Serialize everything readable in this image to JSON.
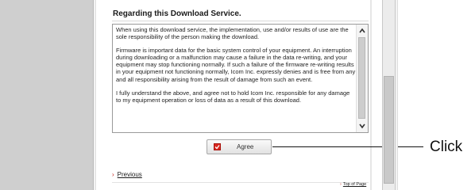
{
  "section": {
    "title": "Regarding this Download Service."
  },
  "terms": {
    "paragraphs": [
      "When using this download service, the implementation, use and/or results of use are the sole responsibility of the person making the download.",
      "Firmware is important data for the basic system control of your equipment. An interruption during downloading or a malfunction may cause a failure in the data re-writing, and your equipment may stop functioning normally. If such a failure of the firmware re-writing results in your equipment not functioning normally, Icom Inc. expressly denies and is free from any and all responsibility arising from the result of damage from such an event.",
      "I fully understand the above, and agree not to hold Icom Inc. responsible for any damage to my equipment operation or loss of data as a result of this download."
    ],
    "scroll_up_icon": "chevron-up",
    "scroll_down_icon": "chevron-down"
  },
  "agree": {
    "label": "Agree",
    "check_icon": "checkbox-icon",
    "check_color": "#d9281f"
  },
  "callout": {
    "text": "Click"
  },
  "nav": {
    "previous_label": "Previous",
    "top_of_page_label": "Top of Page",
    "arrow_icon": "chevron-right",
    "arrow_color": "#c4271d"
  }
}
